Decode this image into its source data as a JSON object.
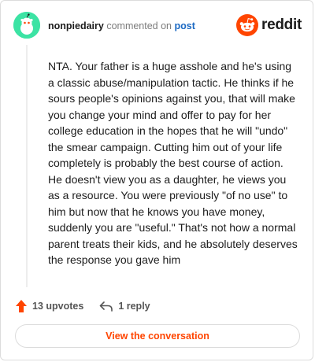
{
  "header": {
    "username": "nonpiedairy",
    "action_text": "commented on",
    "post_link": "post",
    "brand_wordmark": "reddit"
  },
  "icons": {
    "avatar": "snoo-avatar-icon",
    "brand": "reddit-alien-icon",
    "upvote": "upvote-arrow-icon",
    "reply": "reply-arrow-icon"
  },
  "comment": {
    "text": "NTA. Your father is a huge asshole and he's using a classic abuse/manipulation tactic. He thinks if he sours people's opinions against you, that will make you change your mind and offer to pay for her college education in the hopes that he will \"undo\" the smear campaign. Cutting him out of your life completely is probably the best course of action. He doesn't view you as a daughter, he views you as a resource. You were previously \"of no use\" to him but now that he knows you have money, suddenly you are \"useful.\" That's not how a normal parent treats their kids, and he absolutely deserves the response you gave him"
  },
  "footer": {
    "upvotes": "13 upvotes",
    "replies": "1 reply"
  },
  "cta": {
    "label": "View the conversation"
  },
  "colors": {
    "accent": "#ff4500",
    "link": "#1d6ac3",
    "avatar_bg": "#3ce3a4"
  }
}
